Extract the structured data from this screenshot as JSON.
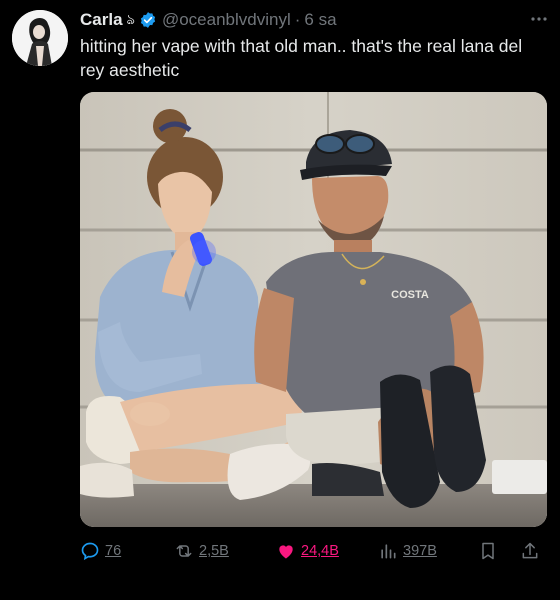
{
  "author": {
    "name": "Carla",
    "name_emoji": "ঌ",
    "handle": "@oceanblvdvinyl",
    "separator": "·",
    "time": "6 sa",
    "verified": true
  },
  "tweet": {
    "text": "hitting her vape with that old man.. that's the real lana del rey aesthetic",
    "shirt_print": "COSTA"
  },
  "stats": {
    "replies": "76",
    "retweets": "2,5B",
    "likes": "24,4B",
    "views": "397B"
  },
  "colors": {
    "background": "#000000",
    "text": "#e7e9ea",
    "muted": "#71767b",
    "like": "#f91880",
    "verified": "#1d9bf0"
  },
  "icons": [
    "verified-badge-icon",
    "more-icon",
    "reply-icon",
    "retweet-icon",
    "like-icon",
    "views-icon",
    "bookmark-icon",
    "share-icon"
  ]
}
